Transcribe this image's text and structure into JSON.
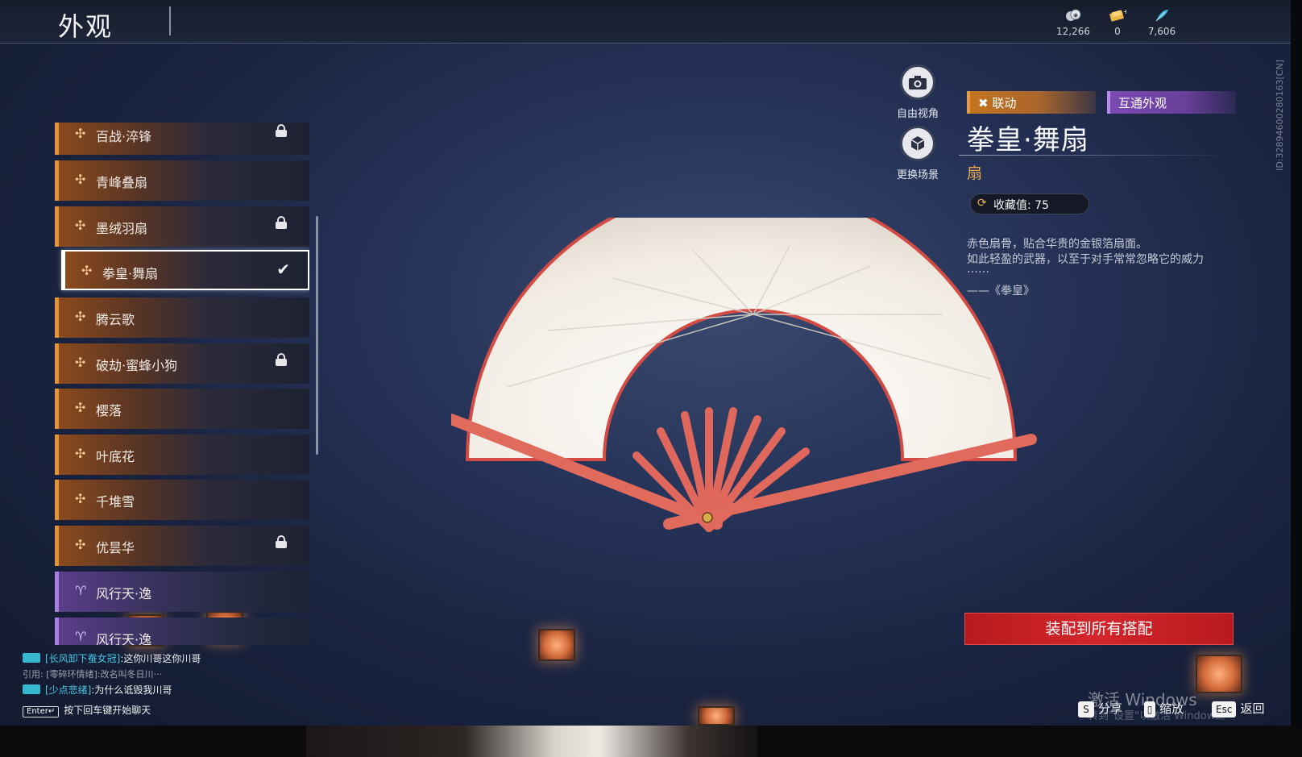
{
  "header": {
    "title": "外观",
    "currencies": [
      {
        "icon": "coin-stack-icon",
        "value": "12,266"
      },
      {
        "icon": "ticket-icon",
        "value": "0"
      },
      {
        "icon": "feather-icon",
        "value": "7,606"
      }
    ]
  },
  "list": {
    "items": [
      {
        "label": "百战·淬锋",
        "locked": true
      },
      {
        "label": "青峰叠扇",
        "locked": false
      },
      {
        "label": "墨绒羽扇",
        "locked": true
      },
      {
        "label": "拳皇·舞扇",
        "locked": false,
        "selected": true
      },
      {
        "label": "腾云歌",
        "locked": false
      },
      {
        "label": "破劫·蜜蜂小狗",
        "locked": true
      },
      {
        "label": "樱落",
        "locked": false
      },
      {
        "label": "叶底花",
        "locked": false
      },
      {
        "label": "千堆雪",
        "locked": false
      },
      {
        "label": "优昙华",
        "locked": true
      },
      {
        "label": "风行天·逸",
        "locked": false,
        "rarity": "purple"
      },
      {
        "label": "风行天·逸",
        "locked": false,
        "rarity": "purple"
      }
    ],
    "check_mark": "✔"
  },
  "view": {
    "free_view": "自由视角",
    "change_scene": "更换场景"
  },
  "detail": {
    "tag_collab": "联动",
    "tag_shared": "互通外观",
    "name": "拳皇·舞扇",
    "type": "扇",
    "collect_label": "收藏值: 75",
    "desc_line1": "赤色扇骨，贴合华贵的金银箔扇面。",
    "desc_line2": "如此轻盈的武器，以至于对手常常忽略它的威力",
    "desc_line3": "……",
    "desc_source": "——《拳皇》",
    "equip_button": "装配到所有搭配",
    "id_text": "ID:32894600280163[CN]"
  },
  "chat": {
    "line1_name": "[长风卸下蚕女冠]",
    "line1_text": ":这你川哥这你川哥",
    "quote": "引用: [零碎环情绪]:改名叫冬日川···",
    "line2_name": "[少点悲绪]",
    "line2_text": ":为什么诋毁我川哥",
    "enter_key": "Enter↵",
    "enter_hint": "按下回车键开始聊天"
  },
  "footer": {
    "share_key": "S",
    "share_label": "分享",
    "zoom_label": "缩放",
    "esc_key": "Esc",
    "back_label": "返回",
    "watermark_line1": "激活 Windows",
    "watermark_line2": "转到\"设置\"以激活 Windows。"
  },
  "colors": {
    "orange_rarity": "#e0953d",
    "purple_rarity": "#a880e0",
    "equip_red": "#d2262b",
    "type_gold": "#e5a752"
  }
}
